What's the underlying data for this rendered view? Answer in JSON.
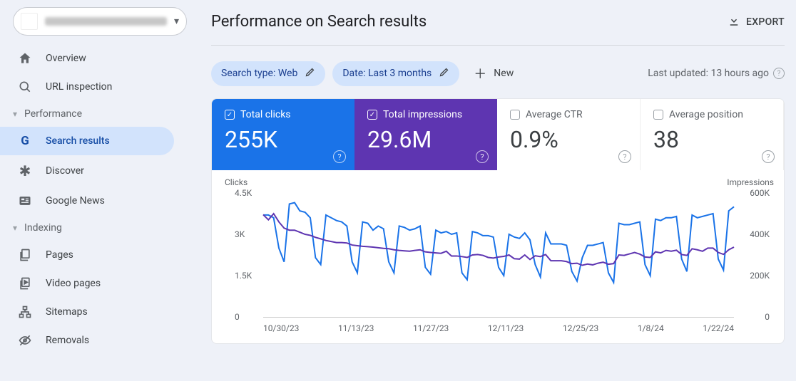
{
  "property_selector": {
    "name_blurred": true
  },
  "sidebar": {
    "overview": "Overview",
    "url_inspection": "URL inspection",
    "sections": {
      "performance": {
        "label": "Performance",
        "items": [
          {
            "id": "search-results",
            "label": "Search results",
            "active": true
          },
          {
            "id": "discover",
            "label": "Discover"
          },
          {
            "id": "google-news",
            "label": "Google News"
          }
        ]
      },
      "indexing": {
        "label": "Indexing",
        "items": [
          {
            "id": "pages",
            "label": "Pages"
          },
          {
            "id": "video-pages",
            "label": "Video pages"
          },
          {
            "id": "sitemaps",
            "label": "Sitemaps"
          },
          {
            "id": "removals",
            "label": "Removals"
          }
        ]
      }
    }
  },
  "header": {
    "title": "Performance on Search results",
    "export_label": "EXPORT"
  },
  "filters": {
    "search_type_chip": "Search type: Web",
    "date_chip": "Date: Last 3 months",
    "new_label": "New",
    "last_updated": "Last updated: 13 hours ago"
  },
  "metrics": {
    "clicks": {
      "label": "Total clicks",
      "value": "255K",
      "checked": true,
      "color": "#1a73e8"
    },
    "impressions": {
      "label": "Total impressions",
      "value": "29.6M",
      "checked": true,
      "color": "#5e35b1"
    },
    "ctr": {
      "label": "Average CTR",
      "value": "0.9%",
      "checked": false
    },
    "position": {
      "label": "Average position",
      "value": "38",
      "checked": false
    }
  },
  "chart_data": {
    "type": "line",
    "title": "",
    "x_categories": [
      "10/30/23",
      "11/13/23",
      "11/27/23",
      "12/11/23",
      "12/25/23",
      "1/8/24",
      "1/22/24"
    ],
    "y_left": {
      "label": "Clicks",
      "ticks": [
        0,
        1500,
        3000,
        4500
      ],
      "tick_labels": [
        "0",
        "1.5K",
        "3K",
        "4.5K"
      ],
      "ylim": [
        0,
        4500
      ]
    },
    "y_right": {
      "label": "Impressions",
      "ticks": [
        0,
        200000,
        400000,
        600000
      ],
      "tick_labels": [
        "0",
        "200K",
        "400K",
        "600K"
      ],
      "ylim": [
        0,
        600000
      ]
    },
    "series": [
      {
        "name": "Clicks",
        "axis": "left",
        "color": "#1a73e8",
        "values": [
          3700,
          3700,
          3600,
          2500,
          2000,
          4100,
          4150,
          3850,
          3800,
          3600,
          2150,
          1900,
          3700,
          3600,
          3500,
          3450,
          3300,
          2000,
          1600,
          3450,
          3400,
          3150,
          3300,
          3200,
          2000,
          1600,
          3300,
          3250,
          3150,
          3200,
          3300,
          1800,
          1550,
          3150,
          3050,
          3100,
          3000,
          3050,
          1600,
          1350,
          3100,
          3050,
          2950,
          2950,
          2900,
          1800,
          1500,
          3000,
          2900,
          2850,
          3050,
          2800,
          1900,
          1450,
          3050,
          2650,
          2650,
          2650,
          2600,
          1650,
          1300,
          2150,
          2600,
          2600,
          2650,
          2700,
          1600,
          1250,
          3400,
          3350,
          3350,
          3400,
          3450,
          1900,
          1500,
          3550,
          3500,
          3600,
          3600,
          3650,
          2100,
          1650,
          3700,
          3600,
          3650,
          3700,
          3750,
          2100,
          1700,
          3850,
          4000
        ]
      },
      {
        "name": "Impressions",
        "axis": "right",
        "color": "#5e35b1",
        "values": [
          495000,
          470000,
          500000,
          460000,
          430000,
          420000,
          420000,
          410000,
          400000,
          395000,
          385000,
          378000,
          370000,
          365000,
          360000,
          360000,
          358000,
          348000,
          345000,
          342000,
          340000,
          338000,
          335000,
          332000,
          330000,
          325000,
          322000,
          320000,
          318000,
          322000,
          325000,
          315000,
          312000,
          310000,
          308000,
          318000,
          295000,
          295000,
          292000,
          288000,
          300000,
          302000,
          298000,
          288000,
          285000,
          290000,
          293000,
          300000,
          282000,
          280000,
          300000,
          278000,
          296000,
          292000,
          302000,
          272000,
          272000,
          272000,
          268000,
          258000,
          260000,
          250000,
          256000,
          252000,
          260000,
          265000,
          255000,
          258000,
          300000,
          298000,
          305000,
          312000,
          304000,
          290000,
          288000,
          315000,
          310000,
          322000,
          318000,
          323000,
          302000,
          298000,
          330000,
          325000,
          318000,
          333000,
          333000,
          312000,
          303000,
          325000,
          338000
        ]
      }
    ]
  }
}
